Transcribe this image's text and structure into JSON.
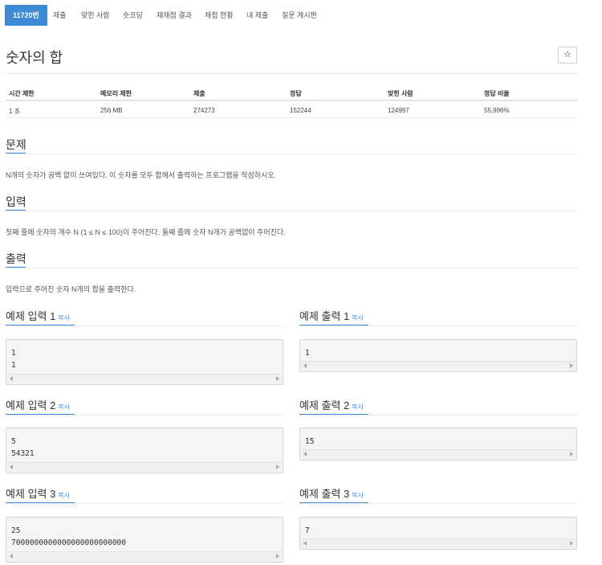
{
  "nav": {
    "items": [
      "11720번",
      "제출",
      "맞힌 사람",
      "숏코딩",
      "재채점 결과",
      "채점 현황",
      "내 제출",
      "질문 게시판"
    ]
  },
  "problem": {
    "title": "숫자의 합",
    "star": "☆"
  },
  "info": {
    "headers": [
      "시간 제한",
      "메모리 제한",
      "제출",
      "정답",
      "맞힌 사람",
      "정답 비율"
    ],
    "values": [
      "1 초",
      "256 MB",
      "274273",
      "152244",
      "124997",
      "55.996%"
    ]
  },
  "sections": {
    "problem_heading": "문제",
    "problem_text": "N개의 숫자가 공백 없이 쓰여있다. 이 숫자를 모두 합해서 출력하는 프로그램을 작성하시오.",
    "input_heading": "입력",
    "input_text": "첫째 줄에 숫자의 개수 N (1 ≤ N ≤ 100)이 주어진다. 둘째 줄에 숫자 N개가 공백없이 주어진다.",
    "output_heading": "출력",
    "output_text": "입력으로 주어진 숫자 N개의 합을 출력한다."
  },
  "samples": {
    "copy_label": "복사",
    "input_1_title": "예제 입력 1",
    "input_1": "1\n1",
    "output_1_title": "예제 출력 1",
    "output_1": "1",
    "input_2_title": "예제 입력 2",
    "input_2": "5\n54321",
    "output_2_title": "예제 출력 2",
    "output_2": "15",
    "input_3_title": "예제 입력 3",
    "input_3": "25\n7000000000000000000000000",
    "output_3_title": "예제 출력 3",
    "output_3": "7"
  },
  "colors": {
    "accent": "#3d8bd4"
  }
}
